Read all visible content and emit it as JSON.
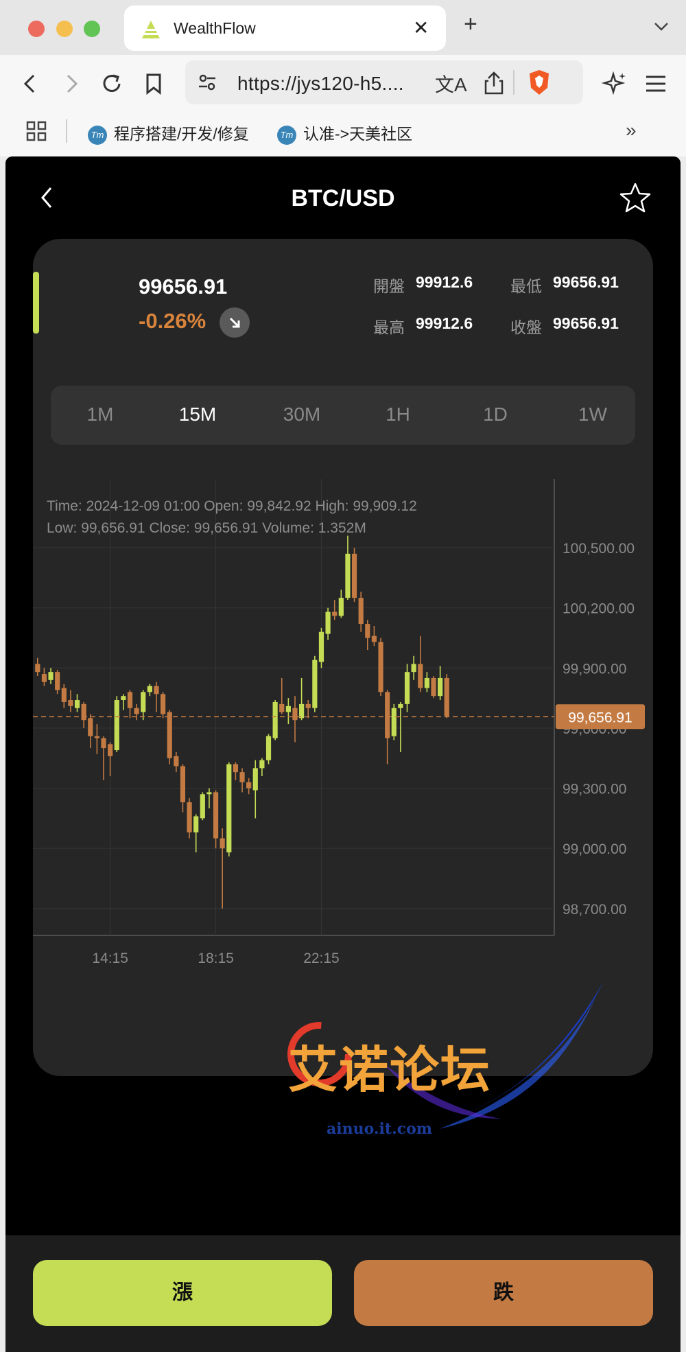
{
  "browser": {
    "tab_title": "WealthFlow",
    "url": "https://jys120-h5....",
    "bookmarks": [
      "程序搭建/开发/修复",
      "认准->天美社区"
    ],
    "bookmark_icon_text": "Tm"
  },
  "app": {
    "pair": "BTC/USD",
    "price": "99656.91",
    "change": "-0.26%",
    "stats": {
      "open_label": "開盤",
      "open": "99912.6",
      "low_label": "最低",
      "low": "99656.91",
      "high_label": "最高",
      "high": "99912.6",
      "close_label": "收盤",
      "close": "99656.91"
    },
    "intervals": [
      "1M",
      "15M",
      "30M",
      "1H",
      "1D",
      "1W"
    ],
    "active_interval": "15M",
    "ohlc_line1": "Time: 2024-12-09 01:00      Open: 99,842.92      High: 99,909.12",
    "ohlc_line2": "Low: 99,656.91      Close: 99,656.91      Volume: 1.352M",
    "buttons": {
      "up": "漲",
      "down": "跌"
    },
    "colors": {
      "up": "#c5dc55",
      "down": "#c37b43",
      "price_tag": "#c37b43"
    }
  },
  "watermark": {
    "text": "艾诺论坛",
    "url": "ainuo.it.com"
  },
  "chart_data": {
    "type": "candlestick",
    "y_ticks": [
      "100,500.00",
      "100,200.00",
      "99,900.00",
      "99,600.00",
      "99,300.00",
      "99,000.00",
      "98,700.00"
    ],
    "x_ticks": [
      "14:15",
      "18:15",
      "22:15"
    ],
    "ylim": [
      98480,
      100740
    ],
    "current_price": 99656.91,
    "current_price_label": "99,656.91",
    "candles": [
      {
        "o": 99920,
        "c": 99880,
        "h": 99950,
        "l": 99860
      },
      {
        "o": 99870,
        "c": 99830,
        "h": 99900,
        "l": 99810
      },
      {
        "o": 99840,
        "c": 99880,
        "h": 99900,
        "l": 99820
      },
      {
        "o": 99880,
        "c": 99790,
        "h": 99890,
        "l": 99770
      },
      {
        "o": 99800,
        "c": 99730,
        "h": 99820,
        "l": 99700
      },
      {
        "o": 99740,
        "c": 99710,
        "h": 99790,
        "l": 99680
      },
      {
        "o": 99700,
        "c": 99740,
        "h": 99770,
        "l": 99680
      },
      {
        "o": 99720,
        "c": 99640,
        "h": 99730,
        "l": 99600
      },
      {
        "o": 99650,
        "c": 99560,
        "h": 99670,
        "l": 99500
      },
      {
        "o": 99560,
        "c": 99550,
        "h": 99620,
        "l": 99470
      },
      {
        "o": 99550,
        "c": 99500,
        "h": 99560,
        "l": 99340
      },
      {
        "o": 99520,
        "c": 99460,
        "h": 99530,
        "l": 99360
      },
      {
        "o": 99490,
        "c": 99740,
        "h": 99760,
        "l": 99480
      },
      {
        "o": 99740,
        "c": 99760,
        "h": 99770,
        "l": 99690
      },
      {
        "o": 99780,
        "c": 99700,
        "h": 99790,
        "l": 99650
      },
      {
        "o": 99700,
        "c": 99670,
        "h": 99720,
        "l": 99640
      },
      {
        "o": 99680,
        "c": 99780,
        "h": 99790,
        "l": 99640
      },
      {
        "o": 99780,
        "c": 99810,
        "h": 99820,
        "l": 99760
      },
      {
        "o": 99810,
        "c": 99770,
        "h": 99830,
        "l": 99680
      },
      {
        "o": 99770,
        "c": 99670,
        "h": 99780,
        "l": 99650
      },
      {
        "o": 99680,
        "c": 99450,
        "h": 99690,
        "l": 99420
      },
      {
        "o": 99460,
        "c": 99410,
        "h": 99480,
        "l": 99380
      },
      {
        "o": 99410,
        "c": 99230,
        "h": 99420,
        "l": 99180
      },
      {
        "o": 99230,
        "c": 99080,
        "h": 99250,
        "l": 99050
      },
      {
        "o": 99080,
        "c": 99160,
        "h": 99170,
        "l": 98980
      },
      {
        "o": 99150,
        "c": 99270,
        "h": 99280,
        "l": 99140
      },
      {
        "o": 99270,
        "c": 99280,
        "h": 99300,
        "l": 99200
      },
      {
        "o": 99280,
        "c": 99050,
        "h": 99290,
        "l": 99000
      },
      {
        "o": 99050,
        "c": 99000,
        "h": 99100,
        "l": 98700
      },
      {
        "o": 98980,
        "c": 99420,
        "h": 99430,
        "l": 98960
      },
      {
        "o": 99420,
        "c": 99380,
        "h": 99430,
        "l": 99340
      },
      {
        "o": 99380,
        "c": 99330,
        "h": 99400,
        "l": 99280
      },
      {
        "o": 99330,
        "c": 99300,
        "h": 99350,
        "l": 99270
      },
      {
        "o": 99290,
        "c": 99400,
        "h": 99440,
        "l": 99150
      },
      {
        "o": 99400,
        "c": 99440,
        "h": 99450,
        "l": 99360
      },
      {
        "o": 99440,
        "c": 99560,
        "h": 99570,
        "l": 99420
      },
      {
        "o": 99550,
        "c": 99730,
        "h": 99740,
        "l": 99540
      },
      {
        "o": 99720,
        "c": 99680,
        "h": 99850,
        "l": 99670
      },
      {
        "o": 99680,
        "c": 99710,
        "h": 99750,
        "l": 99620
      },
      {
        "o": 99700,
        "c": 99640,
        "h": 99760,
        "l": 99530
      },
      {
        "o": 99650,
        "c": 99720,
        "h": 99850,
        "l": 99640
      },
      {
        "o": 99720,
        "c": 99700,
        "h": 99740,
        "l": 99650
      },
      {
        "o": 99700,
        "c": 99940,
        "h": 99960,
        "l": 99680
      },
      {
        "o": 99930,
        "c": 100080,
        "h": 100100,
        "l": 99900
      },
      {
        "o": 100070,
        "c": 100180,
        "h": 100200,
        "l": 100040
      },
      {
        "o": 100180,
        "c": 100160,
        "h": 100240,
        "l": 100140
      },
      {
        "o": 100160,
        "c": 100250,
        "h": 100290,
        "l": 100150
      },
      {
        "o": 100250,
        "c": 100470,
        "h": 100560,
        "l": 100240
      },
      {
        "o": 100470,
        "c": 100250,
        "h": 100500,
        "l": 100230
      },
      {
        "o": 100250,
        "c": 100120,
        "h": 100280,
        "l": 100080
      },
      {
        "o": 100120,
        "c": 100050,
        "h": 100140,
        "l": 99990
      },
      {
        "o": 100060,
        "c": 100030,
        "h": 100110,
        "l": 100010
      },
      {
        "o": 100030,
        "c": 99780,
        "h": 100050,
        "l": 99760
      },
      {
        "o": 99780,
        "c": 99550,
        "h": 99790,
        "l": 99420
      },
      {
        "o": 99560,
        "c": 99700,
        "h": 99720,
        "l": 99540
      },
      {
        "o": 99700,
        "c": 99720,
        "h": 99730,
        "l": 99480
      },
      {
        "o": 99720,
        "c": 99880,
        "h": 99920,
        "l": 99680
      },
      {
        "o": 99880,
        "c": 99920,
        "h": 99960,
        "l": 99840
      },
      {
        "o": 99920,
        "c": 99800,
        "h": 100060,
        "l": 99780
      },
      {
        "o": 99800,
        "c": 99850,
        "h": 99880,
        "l": 99780
      },
      {
        "o": 99850,
        "c": 99760,
        "h": 99860,
        "l": 99750
      },
      {
        "o": 99760,
        "c": 99850,
        "h": 99910,
        "l": 99740
      },
      {
        "o": 99850,
        "c": 99660,
        "h": 99870,
        "l": 99650
      }
    ]
  }
}
